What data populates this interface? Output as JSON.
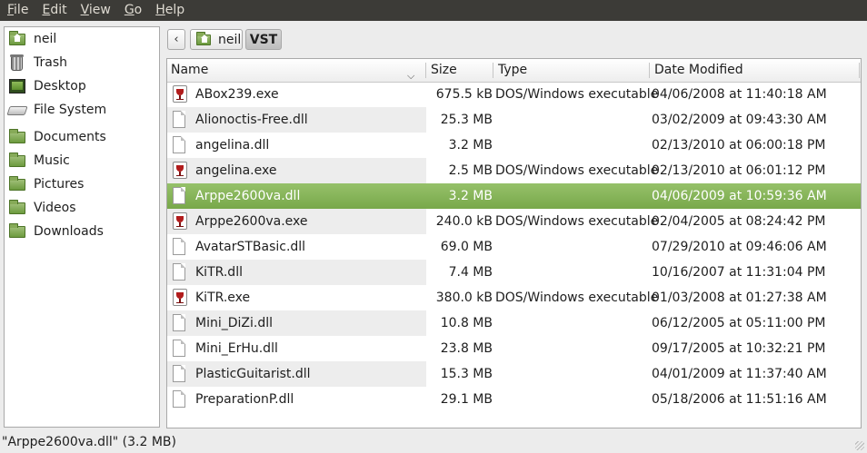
{
  "menubar": {
    "items": [
      {
        "key": "F",
        "rest": "ile"
      },
      {
        "key": "E",
        "rest": "dit"
      },
      {
        "key": "V",
        "rest": "iew"
      },
      {
        "key": "G",
        "rest": "o"
      },
      {
        "key": "H",
        "rest": "elp"
      }
    ]
  },
  "sidebar": {
    "items": [
      {
        "label": "neil",
        "icon": "home-folder-icon"
      },
      {
        "label": "Trash",
        "icon": "trash-icon"
      },
      {
        "label": "Desktop",
        "icon": "desktop-icon"
      },
      {
        "label": "File System",
        "icon": "drive-icon"
      },
      {
        "label": "Documents",
        "icon": "folder-icon"
      },
      {
        "label": "Music",
        "icon": "folder-icon"
      },
      {
        "label": "Pictures",
        "icon": "folder-icon"
      },
      {
        "label": "Videos",
        "icon": "folder-icon"
      },
      {
        "label": "Downloads",
        "icon": "folder-icon"
      }
    ]
  },
  "location": {
    "back_glyph": "‹",
    "crumbs": [
      "neil",
      "VST"
    ]
  },
  "columns": {
    "name": "Name",
    "size": "Size",
    "type": "Type",
    "date": "Date Modified"
  },
  "files": [
    {
      "name": "ABox239.exe",
      "size": "675.5 kB",
      "type": "DOS/Windows executable",
      "date": "04/06/2008 at 11:40:18 AM",
      "kind": "exe"
    },
    {
      "name": "Alionoctis-Free.dll",
      "size": "25.3 MB",
      "type": "",
      "date": "03/02/2009 at 09:43:30 AM",
      "kind": "dll"
    },
    {
      "name": "angelina.dll",
      "size": "3.2 MB",
      "type": "",
      "date": "02/13/2010 at 06:00:18 PM",
      "kind": "dll"
    },
    {
      "name": "angelina.exe",
      "size": "2.5 MB",
      "type": "DOS/Windows executable",
      "date": "02/13/2010 at 06:01:12 PM",
      "kind": "exe"
    },
    {
      "name": "Arppe2600va.dll",
      "size": "3.2 MB",
      "type": "",
      "date": "04/06/2009 at 10:59:36 AM",
      "kind": "dll",
      "selected": true
    },
    {
      "name": "Arppe2600va.exe",
      "size": "240.0 kB",
      "type": "DOS/Windows executable",
      "date": "02/04/2005 at 08:24:42 PM",
      "kind": "exe"
    },
    {
      "name": "AvatarSTBasic.dll",
      "size": "69.0 MB",
      "type": "",
      "date": "07/29/2010 at 09:46:06 AM",
      "kind": "dll"
    },
    {
      "name": "KiTR.dll",
      "size": "7.4 MB",
      "type": "",
      "date": "10/16/2007 at 11:31:04 PM",
      "kind": "dll"
    },
    {
      "name": "KiTR.exe",
      "size": "380.0 kB",
      "type": "DOS/Windows executable",
      "date": "01/03/2008 at 01:27:38 AM",
      "kind": "exe"
    },
    {
      "name": "Mini_DiZi.dll",
      "size": "10.8 MB",
      "type": "",
      "date": "06/12/2005 at 05:11:00 PM",
      "kind": "dll"
    },
    {
      "name": "Mini_ErHu.dll",
      "size": "23.8 MB",
      "type": "",
      "date": "09/17/2005 at 10:32:21 PM",
      "kind": "dll"
    },
    {
      "name": "PlasticGuitarist.dll",
      "size": "15.3 MB",
      "type": "",
      "date": "04/01/2009 at 11:37:40 AM",
      "kind": "dll"
    },
    {
      "name": "PreparationP.dll",
      "size": "29.1 MB",
      "type": "",
      "date": "05/18/2006 at 11:51:16 AM",
      "kind": "dll"
    }
  ],
  "status": {
    "text": "\"Arppe2600va.dll\" (3.2 MB)"
  },
  "colors": {
    "menubar_bg": "#3c3b37",
    "selection": "#86b25a",
    "stripe": "#ededed"
  }
}
